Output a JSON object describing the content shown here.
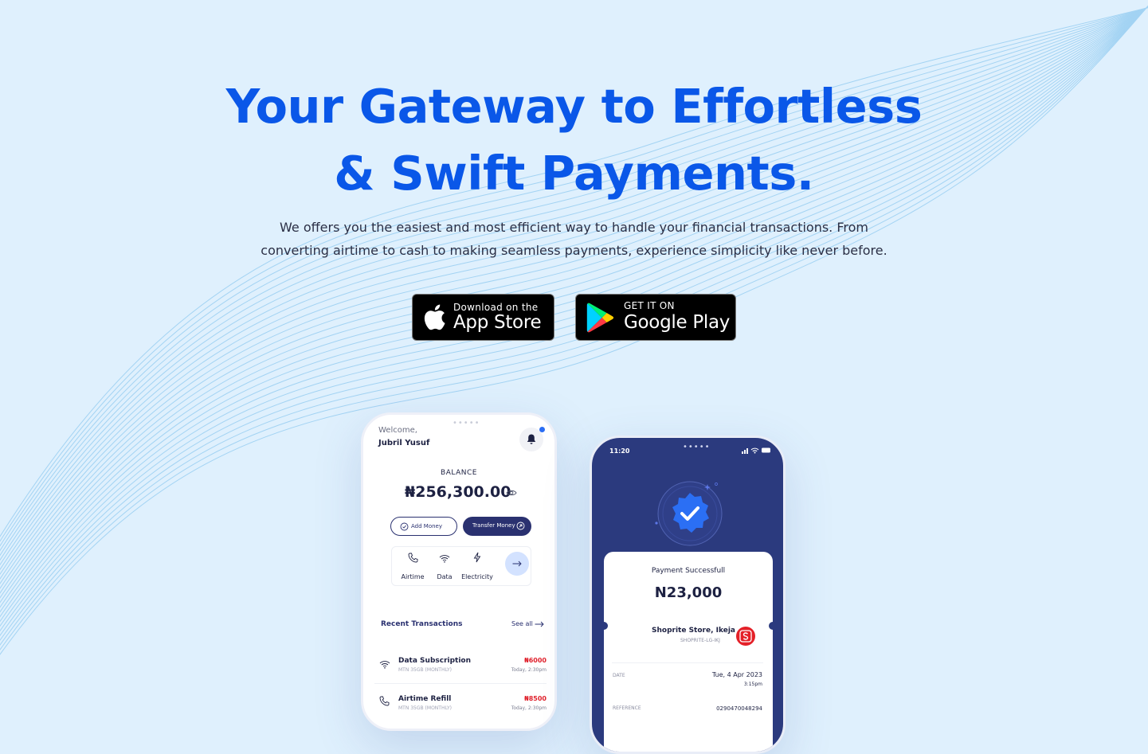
{
  "hero": {
    "title_line1": "Your Gateway to Effortless",
    "title_line2": "& Swift Payments.",
    "subtitle": "We offers you the easiest and most efficient way to handle your financial transactions. From converting airtime to cash to making seamless payments, experience simplicity like never before."
  },
  "stores": {
    "apple": {
      "small": "Download on the",
      "big": "App Store",
      "icon": "apple-icon"
    },
    "google": {
      "small": "GET IT ON",
      "big": "Google Play",
      "icon": "google-play-icon"
    }
  },
  "phone_home": {
    "welcome": "Welcome,",
    "user_name": "Jubril Yusuf",
    "balance_label": "BALANCE",
    "balance_amount": "₦256,300.00",
    "add_money": "Add Money",
    "transfer_money": "Transfer Money",
    "quick_actions": [
      {
        "label": "Airtime",
        "icon": "phone-icon"
      },
      {
        "label": "Data",
        "icon": "wifi-icon"
      },
      {
        "label": "Electricity",
        "icon": "bolt-icon"
      }
    ],
    "recent_title": "Recent Transactions",
    "see_all": "See all",
    "transactions": [
      {
        "title": "Data Subscription",
        "subtitle": "MTN 35GB (MONTHLY)",
        "amount": "₦6000",
        "date": "Today, 2:30pm"
      },
      {
        "title": "Airtime Refill",
        "subtitle": "MTN 35GB (MONTHLY)",
        "amount": "₦8500",
        "date": "Today, 2:30pm"
      }
    ]
  },
  "phone_receipt": {
    "time": "11:20",
    "title": "Payment Successfull",
    "amount": "N23,000",
    "store_name": "Shoprite Store, Ikeja",
    "store_code": "SHOPRITE-LG-IKJ",
    "date_label": "DATE",
    "date_value": "Tue, 4 Apr 2023",
    "time_value": "3:15pm",
    "reference_label": "REFERENCE",
    "reference_value": "0290470048294"
  },
  "colors": {
    "background": "#dff0fd",
    "accent": "#0a57e8",
    "navy": "#2a3170",
    "danger": "#e0222d"
  }
}
